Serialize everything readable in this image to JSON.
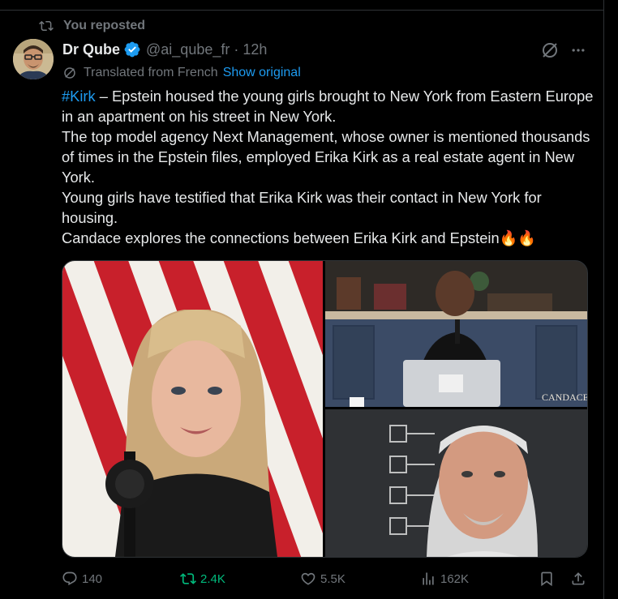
{
  "repost": {
    "label": "You reposted",
    "icon": "repost-icon"
  },
  "post": {
    "author_name": "Dr Qube",
    "handle": "@ai_qube_fr",
    "separator": "·",
    "time": "12h",
    "verified_icon": "verified-badge-icon",
    "translated_label": "Translated from French",
    "show_original_label": "Show original",
    "text": {
      "hashtag": "#Kirk",
      "lines": [
        " – Epstein housed the young girls brought to New York from Eastern Europe in an apartment on his street in New York.",
        "The top model agency Next Management, whose owner is mentioned thousands of times in the Epstein files, employed Erika Kirk as a real estate agent in New York.",
        "Young girls have testified that Erika Kirk was their contact in New York for housing.",
        "Candace explores the connections between Erika Kirk and Epstein🔥🔥"
      ]
    },
    "media": {
      "studio_watermark": "CANDACE"
    }
  },
  "actions": {
    "replies": "140",
    "reposts": "2.4K",
    "likes": "5.5K",
    "views": "162K"
  },
  "colors": {
    "background": "#000000",
    "text_primary": "#e7e9ea",
    "text_secondary": "#71767b",
    "accent": "#1d9bf0",
    "repost_active": "#00ba7c",
    "border": "#2f3336"
  }
}
